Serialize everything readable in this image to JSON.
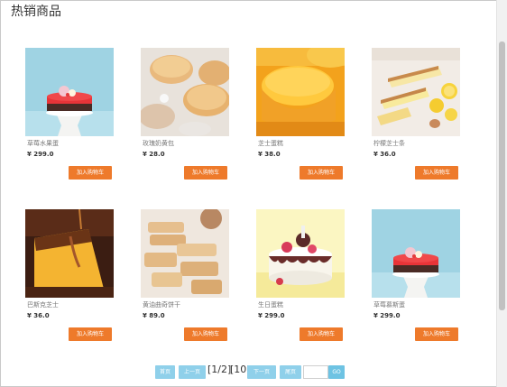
{
  "page": {
    "title": "热销商品"
  },
  "products": [
    {
      "name": "草莓水果蛋",
      "price": "¥ 299.0",
      "button": "加入购物车",
      "image": "red-mousse-cake"
    },
    {
      "name": "玫瑰奶黄包",
      "price": "¥ 28.0",
      "button": "加入购物车",
      "image": "custard-buns"
    },
    {
      "name": "芝士蛋糕",
      "price": "¥ 38.0",
      "button": "加入购物车",
      "image": "cheesecake"
    },
    {
      "name": "柠檬芝士条",
      "price": "¥ 36.0",
      "button": "加入购物车",
      "image": "lemon-bars"
    },
    {
      "name": "巴斯克芝士",
      "price": "¥ 36.0",
      "button": "加入购物车",
      "image": "basque-cheesecake"
    },
    {
      "name": "黄油曲奇饼干",
      "price": "¥ 89.0",
      "button": "加入购物车",
      "image": "butter-cookies"
    },
    {
      "name": "生日蛋糕",
      "price": "¥ 299.0",
      "button": "加入购物车",
      "image": "birthday-cake"
    },
    {
      "name": "草莓慕斯蛋",
      "price": "¥ 299.0",
      "button": "加入购物车",
      "image": "red-mousse-cake"
    }
  ],
  "pagination": {
    "first": "首页",
    "prev": "上一页",
    "current": "[1/2]",
    "total": "[10]",
    "next": "下一页",
    "last": "尾页",
    "go": "GO"
  }
}
